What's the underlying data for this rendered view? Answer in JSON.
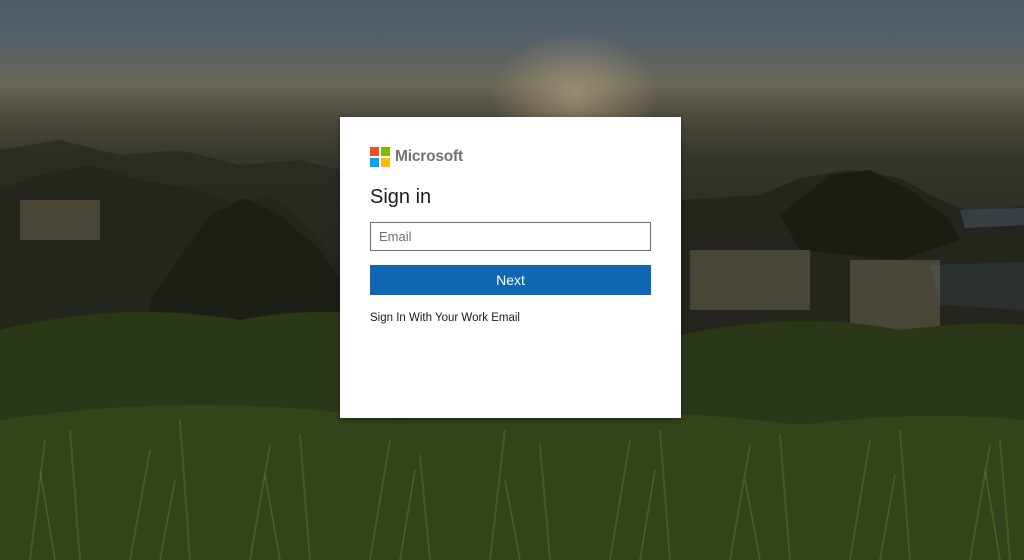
{
  "colors": {
    "primary_button": "#0f67b4",
    "logo_red": "#f25022",
    "logo_green": "#7fba00",
    "logo_blue": "#00a4ef",
    "logo_yellow": "#ffb900"
  },
  "brand": {
    "name": "Microsoft",
    "logo_icon": "microsoft-four-squares-icon"
  },
  "signin": {
    "title": "Sign in",
    "email_placeholder": "Email",
    "email_value": "",
    "next_label": "Next",
    "work_email_link": "Sign In With Your Work Email"
  }
}
